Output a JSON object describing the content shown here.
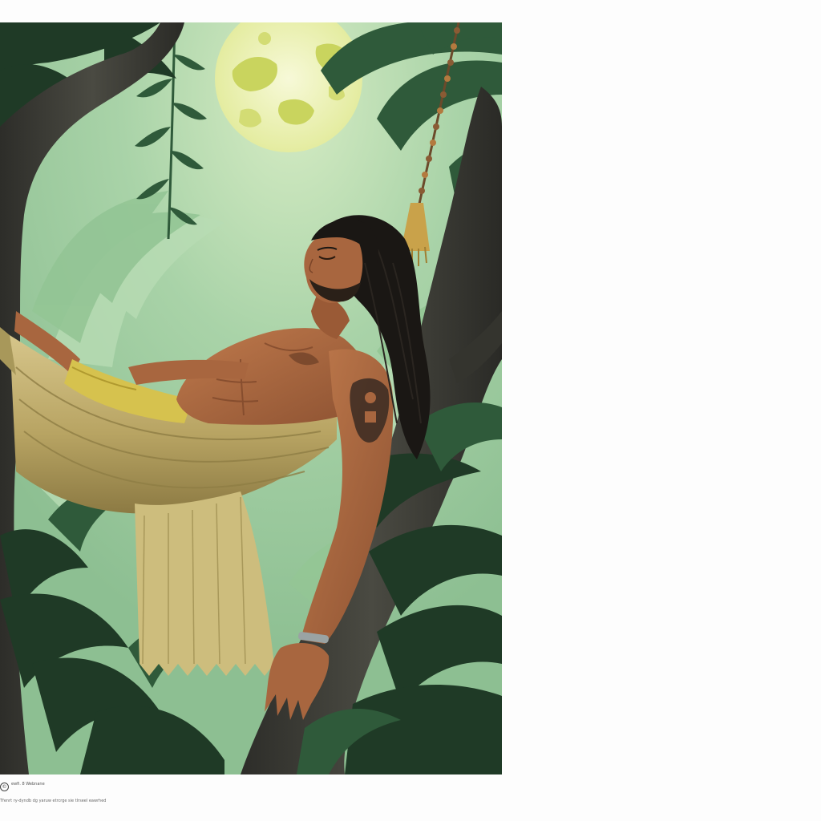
{
  "artwork": {
    "subject": "man resting in a hammock between jungle trees under a full moon",
    "palette": {
      "sky": "#a9d3a8",
      "moon": "#eef3b8",
      "moon_spots": "#c9d45e",
      "trunk": "#3a3a34",
      "foliage_dark": "#1f3a26",
      "foliage_mid": "#3f6b47",
      "hammock": "#c9b777",
      "hammock_shadow": "#8f7e45",
      "skin": "#a8663f",
      "hair": "#1a1714",
      "tattoo": "#3a2a22"
    }
  },
  "credit": {
    "icon": "copyright-icon",
    "name": "ewfi. 8 Webnane",
    "line": "Tfenrt ry-dyndb dg yaruw etrcrge sie tlrseel eawrhed"
  }
}
